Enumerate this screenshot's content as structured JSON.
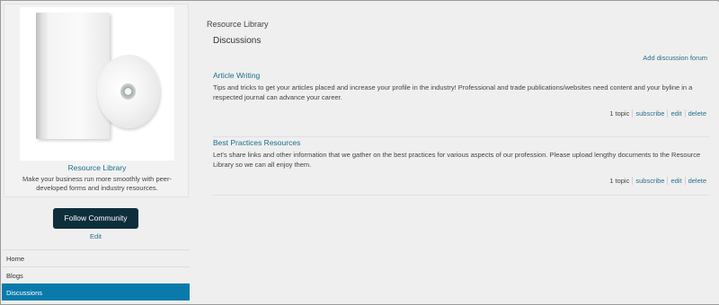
{
  "sidebar": {
    "card": {
      "title": "Resource Library",
      "description": "Make your business run more smoothly with peer-developed forms and industry resources."
    },
    "follow_label": "Follow Community",
    "edit_label": "Edit",
    "nav": [
      {
        "label": "Home",
        "active": false
      },
      {
        "label": "Blogs",
        "active": false
      },
      {
        "label": "Discussions",
        "active": true
      }
    ]
  },
  "main": {
    "breadcrumb": "Resource Library",
    "heading": "Discussions",
    "add_forum_label": "Add discussion forum",
    "forums": [
      {
        "title": "Article Writing",
        "description": "Tips and tricks to get your articles placed and increase your profile in the industry! Professional and trade publications/websites need content and your byline in a respected journal can advance your career.",
        "topics": "1 topic",
        "subscribe": "subscribe",
        "edit": "edit",
        "delete": "delete"
      },
      {
        "title": "Best Practices Resources",
        "description": "Let's share links and other information that we gather on the best practices for various aspects of our profession. Please upload lengthy documents to the Resource Library so we can all enjoy them.",
        "topics": "1 topic",
        "subscribe": "subscribe",
        "edit": "edit",
        "delete": "delete"
      }
    ]
  },
  "colors": {
    "accent": "#0a7aab",
    "button_dark": "#0f2e3c",
    "link": "#2a6f8e"
  }
}
